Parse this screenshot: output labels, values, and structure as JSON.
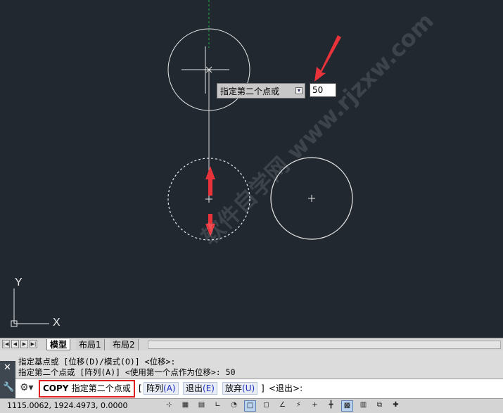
{
  "dynamic_input": {
    "prompt": "指定第二个点或",
    "value": "50"
  },
  "axis": {
    "y": "Y",
    "x": "X"
  },
  "watermark": "软件自学网 www.rjzxw.com",
  "tabs": {
    "model": "模型",
    "layout1": "布局1",
    "layout2": "布局2"
  },
  "command_history": [
    "指定基点或 [位移(D)/模式(O)] <位移>:",
    "指定第二个点或 [阵列(A)] <使用第一个点作为位移>: 50"
  ],
  "command_line": {
    "command": "COPY",
    "prompt": "指定第二个点或",
    "open_bracket": "[",
    "options": [
      {
        "label": "阵列",
        "key": "(A)"
      },
      {
        "label": "退出",
        "key": "(E)"
      },
      {
        "label": "放弃",
        "key": "(U)"
      }
    ],
    "close_bracket": "]",
    "default": "<退出>:"
  },
  "status": {
    "coordinates": "1115.0062,  1924.4973,  0.0000"
  },
  "colors": {
    "canvas_bg": "#212830",
    "highlight_border": "#e02020",
    "arrow": "#e8333a",
    "option_key": "#2030c0"
  },
  "icons": {
    "close": "close-icon",
    "customize": "wrench-icon",
    "command": "command-icon",
    "dropdown": "chevron-down-icon"
  },
  "status_toggles": [
    {
      "name": "infer-constraints-toggle",
      "glyph": "⊹",
      "on": false
    },
    {
      "name": "snap-toggle",
      "glyph": "▦",
      "on": false
    },
    {
      "name": "grid-toggle",
      "glyph": "▤",
      "on": false
    },
    {
      "name": "ortho-toggle",
      "glyph": "∟",
      "on": false
    },
    {
      "name": "polar-toggle",
      "glyph": "◔",
      "on": false
    },
    {
      "name": "osnap-toggle",
      "glyph": "□",
      "on": true
    },
    {
      "name": "3dosnap-toggle",
      "glyph": "◻",
      "on": false
    },
    {
      "name": "otrack-toggle",
      "glyph": "∠",
      "on": false
    },
    {
      "name": "ducs-toggle",
      "glyph": "⚡",
      "on": false
    },
    {
      "name": "dyn-toggle",
      "glyph": "+",
      "on": false
    },
    {
      "name": "lwt-toggle",
      "glyph": "╋",
      "on": false
    },
    {
      "name": "tpy-toggle",
      "glyph": "▩",
      "on": true
    },
    {
      "name": "qp-toggle",
      "glyph": "▥",
      "on": false
    },
    {
      "name": "sc-toggle",
      "glyph": "⧉",
      "on": false
    },
    {
      "name": "am-toggle",
      "glyph": "✚",
      "on": false
    }
  ]
}
